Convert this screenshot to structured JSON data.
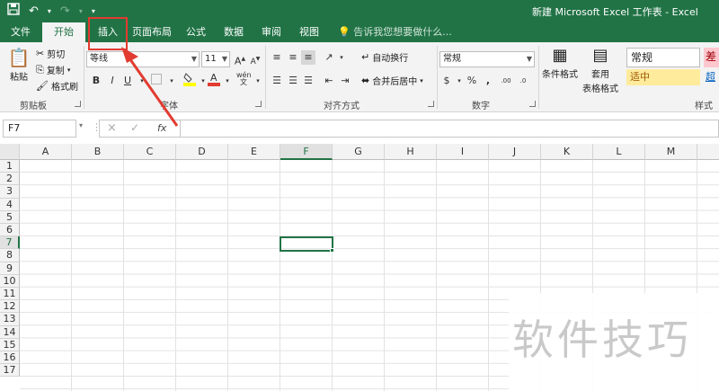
{
  "window": {
    "title": "新建 Microsoft Excel 工作表 - Excel"
  },
  "qat": {
    "save_icon": "save-icon",
    "undo_icon": "undo-icon",
    "redo_icon": "redo-icon",
    "customize_icon": "chevron-down-icon"
  },
  "tabs": [
    {
      "label": "文件",
      "active": false
    },
    {
      "label": "开始",
      "active": true
    },
    {
      "label": "插入",
      "active": false
    },
    {
      "label": "页面布局",
      "active": false
    },
    {
      "label": "公式",
      "active": false
    },
    {
      "label": "数据",
      "active": false
    },
    {
      "label": "审阅",
      "active": false
    },
    {
      "label": "视图",
      "active": false
    }
  ],
  "tell_me": "告诉我您想要做什么...",
  "ribbon": {
    "clipboard": {
      "paste": "粘贴",
      "cut": "剪切",
      "copy": "复制",
      "format_painter": "格式刷",
      "label": "剪贴板"
    },
    "font": {
      "font_name": "等线",
      "font_size": "11",
      "label": "字体",
      "bold": "B",
      "italic": "I",
      "underline": "U"
    },
    "alignment": {
      "wrap_text": "自动换行",
      "merge_center": "合并后居中",
      "label": "对齐方式"
    },
    "number": {
      "format": "常规",
      "percent": "%",
      "comma": ",",
      "label": "数字"
    },
    "styles": {
      "conditional_format": "条件格式",
      "table_format_1": "套用",
      "table_format_2": "表格格式",
      "normal": "常规",
      "bad": "差",
      "neutral": "适中",
      "hyperlink": "超",
      "label": "样式"
    }
  },
  "formula_bar": {
    "name_box": "F7",
    "fx": "fx",
    "cancel": "×",
    "enter": "✓",
    "value": ""
  },
  "columns": [
    "A",
    "B",
    "C",
    "D",
    "E",
    "F",
    "G",
    "H",
    "I",
    "J",
    "K",
    "L",
    "M"
  ],
  "rows": [
    "1",
    "2",
    "3",
    "4",
    "5",
    "6",
    "7",
    "8",
    "9",
    "10",
    "11",
    "12",
    "13",
    "14",
    "15",
    "16",
    "17"
  ],
  "selection": {
    "cell": "F7",
    "column": "F",
    "row": "7"
  },
  "watermark": "软件技巧",
  "colors": {
    "excel_green": "#217346",
    "annotation_red": "#e23b30"
  }
}
